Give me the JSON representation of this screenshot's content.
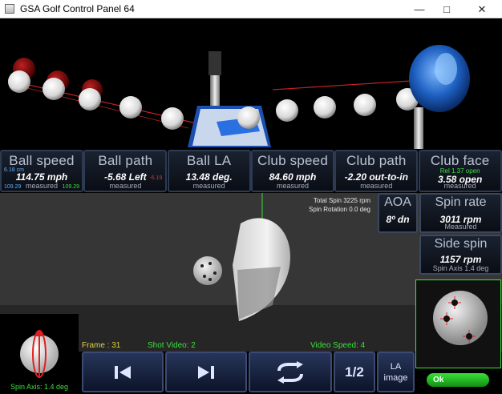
{
  "window": {
    "title": "GSA Golf Control Panel 64",
    "minimize_glyph": "—",
    "maximize_glyph": "□",
    "close_glyph": "✕"
  },
  "tiles": [
    {
      "label": "Ball speed",
      "value": "114.75 mph",
      "sub": "measured",
      "extra_top_left": "6.18 cm",
      "extra_bottom_left": "109.29",
      "extra_bottom_right": "109.29"
    },
    {
      "label": "Ball path",
      "value": "-5.68 Left",
      "sub": "measured",
      "extra_right": "-6.19"
    },
    {
      "label": "Ball LA",
      "value": "13.48 deg.",
      "sub": "measured"
    },
    {
      "label": "Club speed",
      "value": "84.60 mph",
      "sub": "measured"
    },
    {
      "label": "Club path",
      "value": "-2.20 out-to-in",
      "sub": "measured"
    },
    {
      "label": "Club face",
      "value": "3.58 open",
      "sub": "measured",
      "extra_top": "Rel 1.37 open"
    }
  ],
  "video_info": {
    "total_spin": "Total Spin 3225 rpm",
    "spin_rotation": "Spin Rotation 0.0 deg"
  },
  "aoa": {
    "label": "AOA",
    "value": "8º dn"
  },
  "spin_rate": {
    "label": "Spin rate",
    "value": "3011 rpm",
    "sub": "Measured"
  },
  "side_spin": {
    "label": "Side spin",
    "value": "1157 rpm",
    "sub": "Spin Axis 1.4 deg"
  },
  "status": {
    "frame": "Frame : 31",
    "shot_video": "Shot Video: 2",
    "video_speed": "Video Speed: 4"
  },
  "buttons": {
    "half": "1/2",
    "la_line1": "LA",
    "la_line2": "image",
    "ok": "Ok"
  },
  "spin_ball": {
    "axis_text": "Spin Axis: 1.4 deg"
  },
  "colors": {
    "accent_green": "#3ce03c",
    "highlight_yellow": "#e0d040",
    "tile_border": "#2c3a52",
    "button_blue": "#27355a"
  }
}
